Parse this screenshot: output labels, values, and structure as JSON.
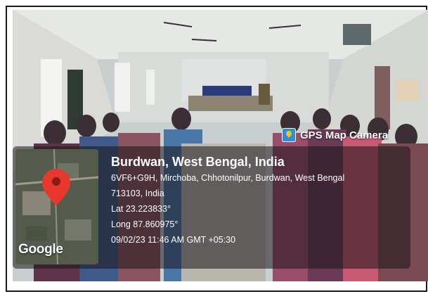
{
  "camera_badge": {
    "label": "GPS Map Camera",
    "icon": "gps-camera-icon"
  },
  "map_thumbnail": {
    "brand": "Google",
    "pin_icon": "map-pin-icon",
    "pin_color": "#e8382d"
  },
  "location": {
    "city_line": "Burdwan, West Bengal, India",
    "address_line_1": "6VF6+G9H, Mirchoba, Chhotonilpur, Burdwan, West Bengal",
    "address_line_2": "713103, India",
    "latitude": "Lat 23.223833°",
    "longitude": "Long 87.860975°",
    "timestamp": "09/02/23 11:46 AM GMT +05:30"
  },
  "colors": {
    "overlay": "#191419",
    "badge_icon": "#2e8fd6"
  }
}
